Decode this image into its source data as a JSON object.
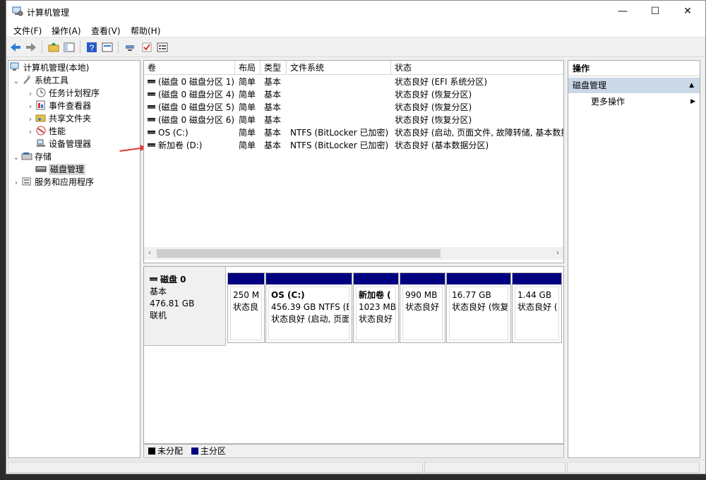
{
  "window": {
    "title": "计算机管理",
    "minimize": "—",
    "maximize": "☐",
    "close": "✕"
  },
  "menu": [
    "文件(F)",
    "操作(A)",
    "查看(V)",
    "帮助(H)"
  ],
  "tree": {
    "root": "计算机管理(本地)",
    "system_tools": "系统工具",
    "task_scheduler": "任务计划程序",
    "event_viewer": "事件查看器",
    "shared_folders": "共享文件夹",
    "performance": "性能",
    "device_manager": "设备管理器",
    "storage": "存储",
    "disk_management": "磁盘管理",
    "services_apps": "服务和应用程序"
  },
  "volumes": {
    "headers": [
      "卷",
      "布局",
      "类型",
      "文件系统",
      "状态"
    ],
    "rows": [
      [
        "(磁盘 0 磁盘分区 1)",
        "简单",
        "基本",
        "",
        "状态良好 (EFI 系统分区)"
      ],
      [
        "(磁盘 0 磁盘分区 4)",
        "简单",
        "基本",
        "",
        "状态良好 (恢复分区)"
      ],
      [
        "(磁盘 0 磁盘分区 5)",
        "简单",
        "基本",
        "",
        "状态良好 (恢复分区)"
      ],
      [
        "(磁盘 0 磁盘分区 6)",
        "简单",
        "基本",
        "",
        "状态良好 (恢复分区)"
      ],
      [
        "OS (C:)",
        "简单",
        "基本",
        "NTFS (BitLocker 已加密)",
        "状态良好 (启动, 页面文件, 故障转储, 基本数据"
      ],
      [
        "新加卷 (D:)",
        "简单",
        "基本",
        "NTFS (BitLocker 已加密)",
        "状态良好 (基本数据分区)"
      ]
    ]
  },
  "disk": {
    "name": "磁盘 0",
    "type": "基本",
    "size": "476.81 GB",
    "state": "联机",
    "partitions": [
      {
        "name": "",
        "size": "250 M",
        "status": "状态良"
      },
      {
        "name": "OS  (C:)",
        "size": "456.39 GB NTFS (B",
        "status": "状态良好 (启动, 页面"
      },
      {
        "name": "新加卷  (",
        "size": "1023 MB",
        "status": "状态良好"
      },
      {
        "name": "",
        "size": "990 MB",
        "status": "状态良好"
      },
      {
        "name": "",
        "size": "16.77 GB",
        "status": "状态良好 (恢复"
      },
      {
        "name": "",
        "size": "1.44 GB",
        "status": "状态良好 ("
      }
    ]
  },
  "legend": {
    "unallocated": "未分配",
    "primary": "主分区"
  },
  "actions": {
    "header": "操作",
    "selected": "磁盘管理",
    "more": "更多操作"
  },
  "colors": {
    "primary_partition": "#000080",
    "unallocated": "#000000",
    "selected_action": "#cbd8e8",
    "arrow": "#e53935"
  }
}
